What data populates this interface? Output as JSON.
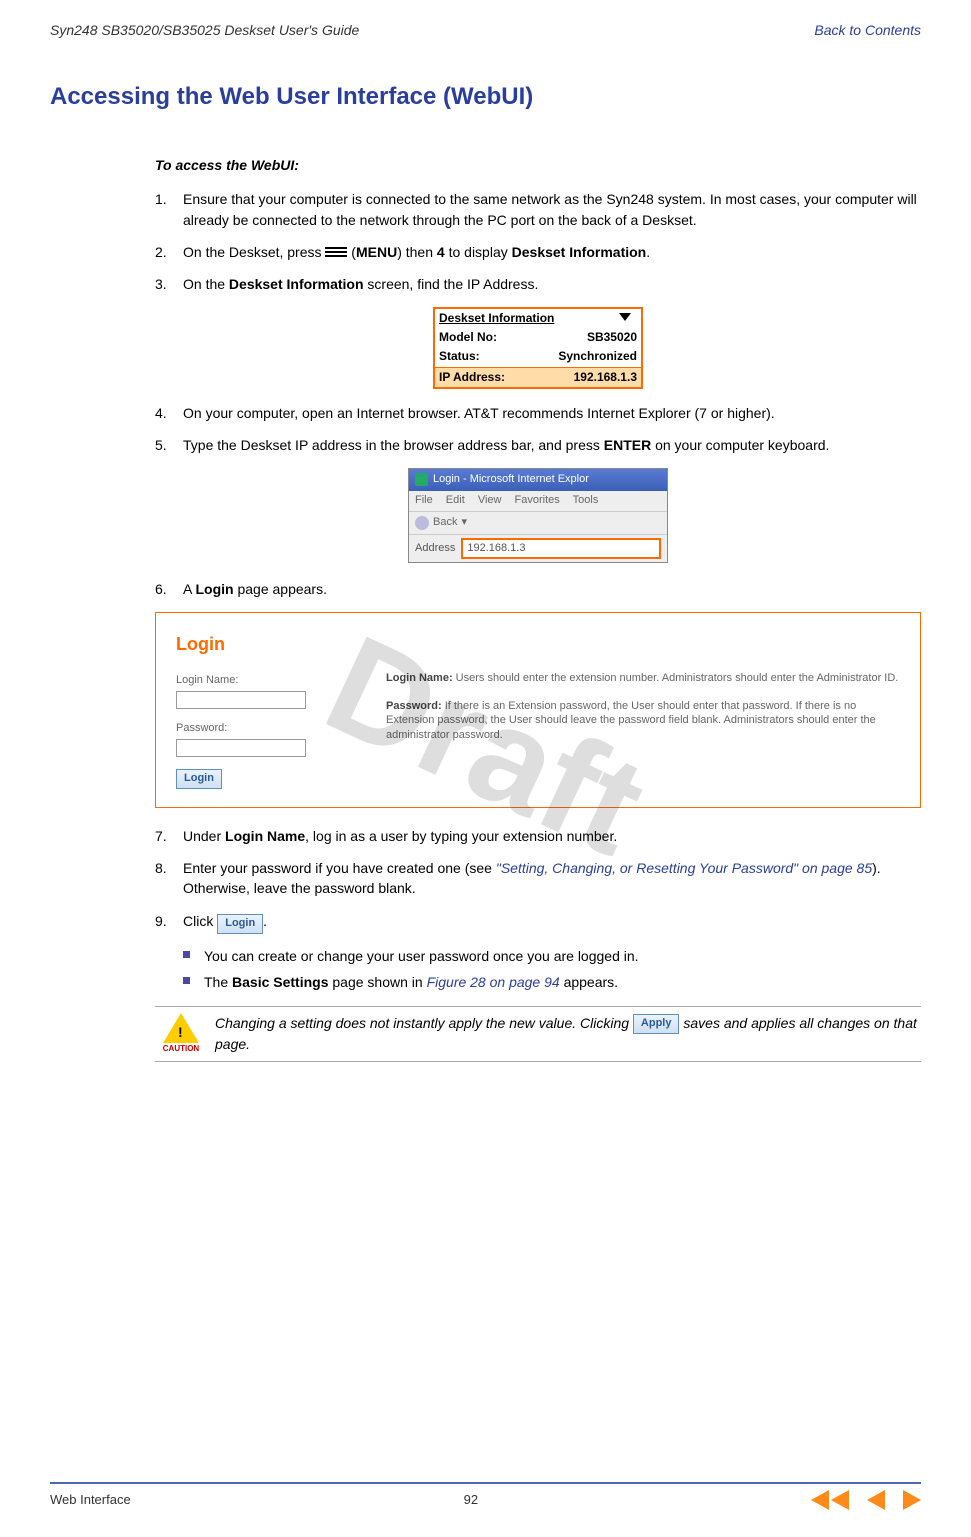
{
  "header": {
    "left": "Syn248 SB35020/SB35025 Deskset User's Guide",
    "right": "Back to Contents"
  },
  "title": "Accessing the Web User Interface (WebUI)",
  "intro_heading": "To access the WebUI:",
  "steps": {
    "s1": {
      "num": "1.",
      "text": "Ensure that your computer is connected to the same network as the Syn248 system. In most cases, your computer will already be connected to the network through the PC port on the back of a Deskset."
    },
    "s2": {
      "num": "2.",
      "prefix": "On the Deskset, press ",
      "menuWord": "MENU",
      "mid": ") then ",
      "four": "4",
      "mid2": " to display ",
      "tail": "Deskset Information",
      "period": "."
    },
    "s3": {
      "num": "3.",
      "prefix": "On the ",
      "b1": "Deskset Information",
      "suffix": " screen, find the IP Address."
    },
    "s4": {
      "num": "4.",
      "text": "On your computer, open an Internet browser. AT&T recommends Internet Explorer (7 or higher)."
    },
    "s5": {
      "num": "5.",
      "prefix": "Type the Deskset IP address in the browser address bar, and press ",
      "b1": "ENTER",
      "suffix": " on your computer keyboard."
    },
    "s6": {
      "num": "6.",
      "prefix": "A ",
      "b1": "Login",
      "suffix": " page appears."
    },
    "s7": {
      "num": "7.",
      "prefix": "Under ",
      "b1": "Login Name",
      "suffix": ", log in as a user by typing your extension number."
    },
    "s8": {
      "num": "8.",
      "prefix": "Enter your password if you have created one (see ",
      "link": "\"Setting, Changing, or Resetting Your Password\" on page 85",
      "suffix": "). Otherwise, leave the password blank."
    },
    "s9": {
      "num": "9.",
      "prefix": "Click ",
      "btn": "Login",
      "suffix": "."
    }
  },
  "deskset_box": {
    "title": "Deskset Information",
    "rows": [
      {
        "k": "Model No:",
        "v": "SB35020"
      },
      {
        "k": "Status:",
        "v": "Synchronized"
      },
      {
        "k": "IP Address:",
        "v": "192.168.1.3"
      }
    ]
  },
  "browser": {
    "title": "Login - Microsoft Internet Explor",
    "menus": [
      "File",
      "Edit",
      "View",
      "Favorites",
      "Tools"
    ],
    "back": "Back",
    "addrLabel": "Address",
    "addrValue": "192.168.1.3"
  },
  "login": {
    "heading": "Login",
    "loginNameLabel": "Login Name:",
    "passwordLabel": "Password:",
    "loginBtn": "Login",
    "helpName": "Login Name:",
    "helpNameText": "  Users should enter the extension number. Administrators should enter the Administrator ID.",
    "helpPw": "Password:",
    "helpPwText": "  If there is an Extension password, the User should enter that password. If there is no Extension password, the User should leave the password field blank. Administrators should enter the administrator password."
  },
  "sub_bullets": {
    "b1": "You can create or change your user password once you are logged in.",
    "b2_prefix": "The ",
    "b2_bold": "Basic Settings",
    "b2_mid": " page shown in ",
    "b2_link": "Figure 28 on page 94",
    "b2_suffix": " appears."
  },
  "caution": {
    "label": "CAUTION",
    "text1": "Changing a setting does not instantly apply the new value. Clicking ",
    "apply": "Apply",
    "text2": " saves and applies all changes on that page."
  },
  "footer": {
    "left": "Web Interface",
    "page": "92"
  },
  "watermark": "Draft"
}
